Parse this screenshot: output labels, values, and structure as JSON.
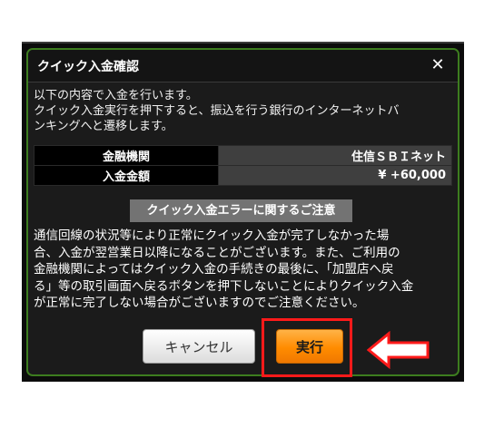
{
  "dialog": {
    "title": "クイック入金確認",
    "close": "✕",
    "intro_line1": "以下の内容で入金を行います。",
    "intro_line2": "クイック入金実行を押下すると、振込を行う銀行のインターネットバ",
    "intro_line3": "ンキングへと遷移します。",
    "rows": [
      {
        "label": "金融機関",
        "value": "住信ＳＢＩネット"
      },
      {
        "label": "入金金額",
        "value": "¥ +60,000"
      }
    ],
    "notice_label": "クイック入金エラーに関するご注意",
    "body_lines": [
      "通信回線の状況等により正常にクイック入金が完了しなかった場",
      "合、入金が翌営業日以降になることがございます。また、ご利用の",
      "金融機関によってはクイック入金の手続きの最後に、「加盟店へ戻",
      "る」等の取引画面へ戻るボタンを押下しないことによりクイック入金",
      "が正常に完了しない場合がございますのでご注意ください。"
    ],
    "cancel_label": "キャンセル",
    "execute_label": "実行"
  },
  "colors": {
    "accent_border": "#3d7d1f",
    "execute_button": "#ff8c00",
    "annotation": "#ff1a1a"
  },
  "icons": {
    "close": "close-icon",
    "annotation": "outline-arrow-left-icon"
  }
}
